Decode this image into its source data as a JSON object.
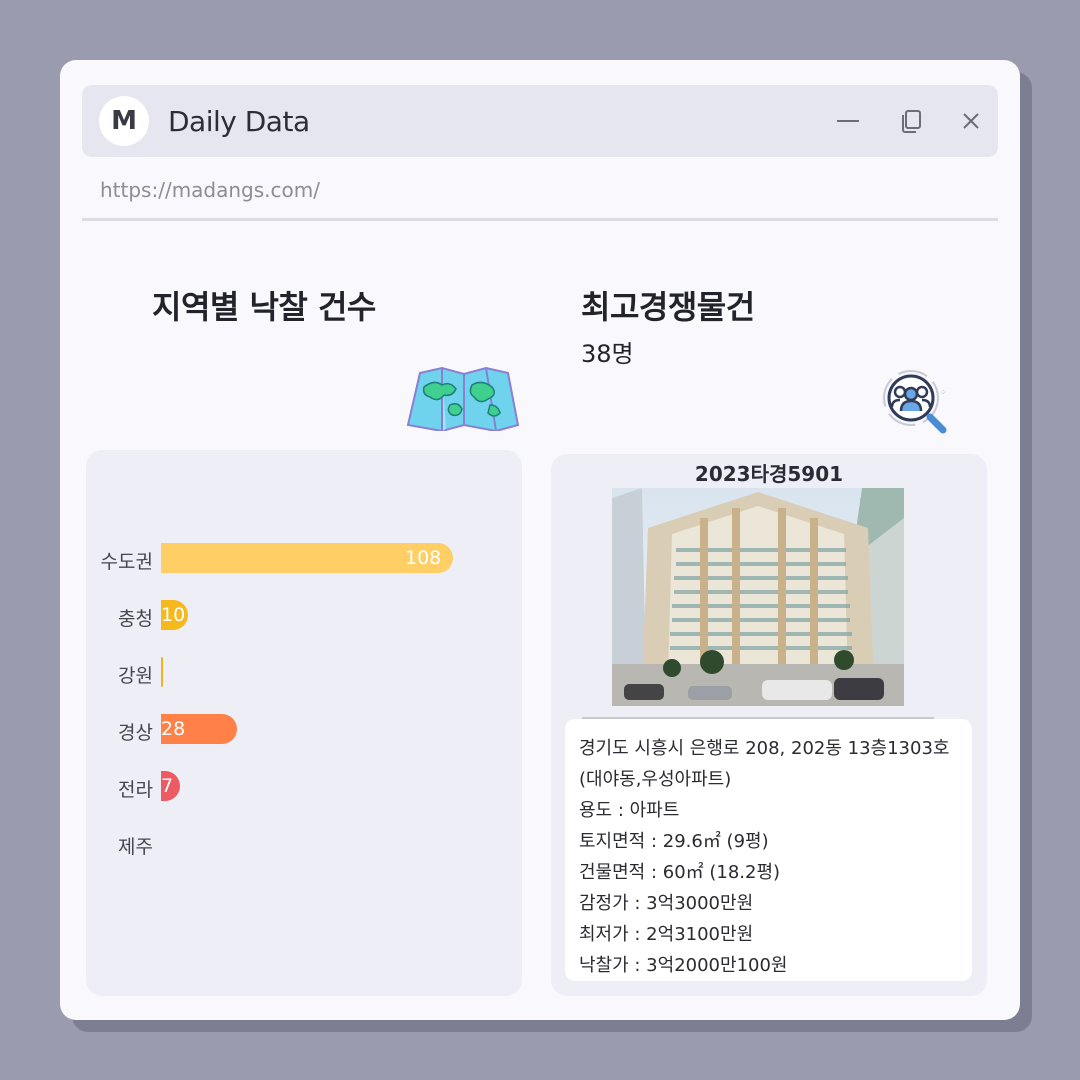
{
  "window": {
    "logo_letter": "M",
    "title": "Daily Data",
    "url": "https://madangs.com/",
    "controls": [
      "minimize-icon",
      "restore-icon",
      "close-icon"
    ]
  },
  "left": {
    "heading": "지역별 낙찰 건수",
    "icon": "map-icon"
  },
  "right": {
    "heading": "최고경쟁물건",
    "value": "38명",
    "icon": "people-search-icon"
  },
  "chart_data": {
    "type": "bar",
    "orientation": "horizontal",
    "categories": [
      "수도권",
      "충청",
      "강원",
      "경상",
      "전라",
      "제주"
    ],
    "values": [
      108,
      10,
      0,
      28,
      7,
      null
    ],
    "labels": [
      "108",
      "10",
      "",
      "28",
      "7",
      ""
    ],
    "colors": [
      "#ffcf66",
      "#f5b81d",
      "#f0b41a",
      "#ff8148",
      "#ec5a62",
      "#cccccc"
    ]
  },
  "property": {
    "case_number": "2023타경5901",
    "address": "경기도 시흥시 은행로 208, 202동 13층1303호",
    "complex": "(대야동,우성아파트)",
    "usage": "용도 : 아파트",
    "land_area": "토지면적 : 29.6㎡ (9평)",
    "building_area": "건물면적 : 60㎡ (18.2평)",
    "appraisal": "감정가 : 3억3000만원",
    "minimum": "최저가 : 2억3100만원",
    "winning_bid": "낙찰가 : 3억2000만100원"
  }
}
